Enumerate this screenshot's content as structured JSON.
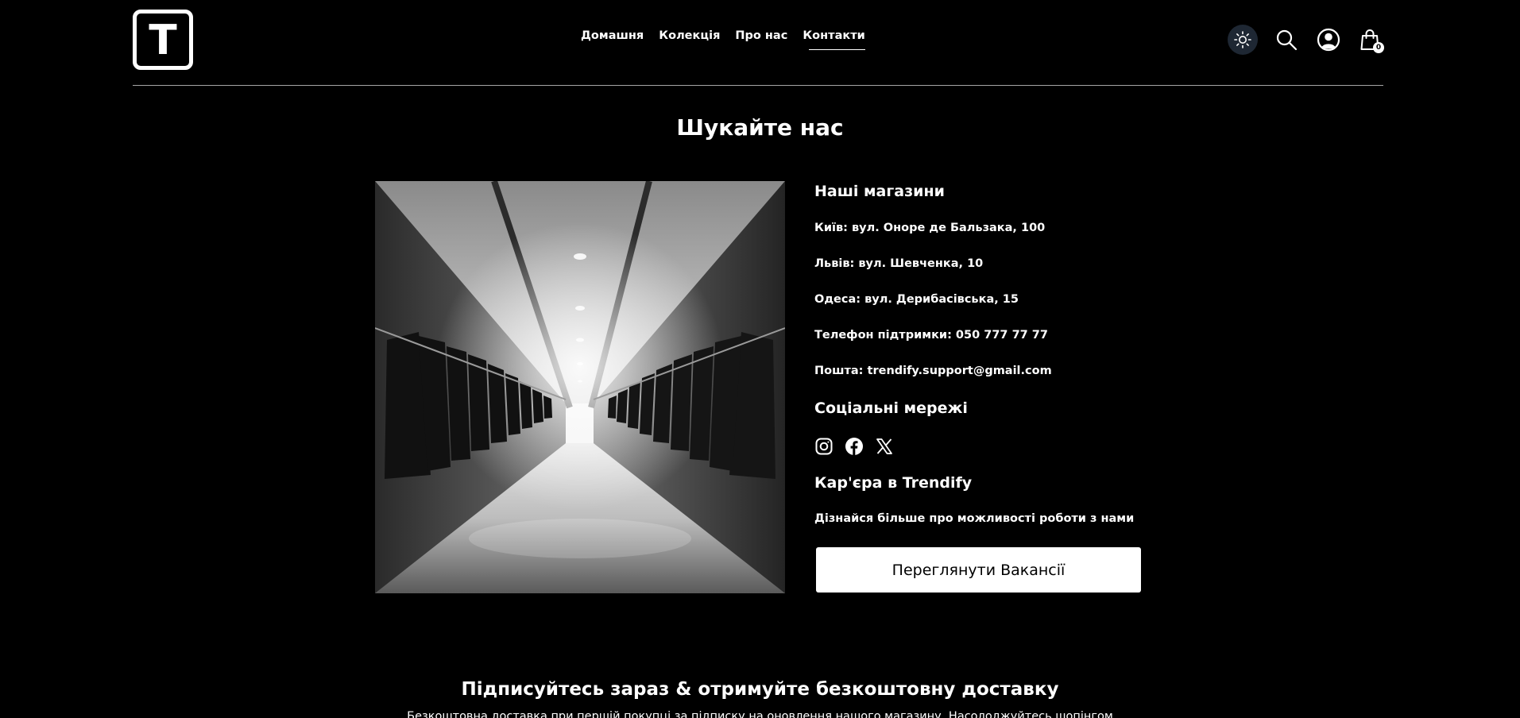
{
  "header": {
    "logo_letter": "T",
    "nav": [
      {
        "label": "Домашня"
      },
      {
        "label": "Колекція"
      },
      {
        "label": "Про нас"
      },
      {
        "label": "Контакти",
        "active": true
      }
    ],
    "icons": [
      "sun-icon",
      "search-icon",
      "user-icon",
      "cart-icon"
    ],
    "cart_count": "0"
  },
  "main": {
    "title": "Шукайте нас",
    "stores_title": "Наші магазини",
    "stores": [
      "Київ: вул. Оноре де Бальзака, 100",
      "Львів: вул. Шевченка, 10",
      "Одеса: вул. Дерибасівська, 15"
    ],
    "phone": "Телефон підтримки: 050 777 77 77",
    "email": "Пошта: trendify.support@gmail.com",
    "social_title": "Соціальні мережі",
    "social_icons": [
      "instagram-icon",
      "facebook-icon",
      "x-icon"
    ],
    "career_title": "Кар'єра в Trendify",
    "career_text": "Дізнайся більше про можливості роботи з нами",
    "vacancies_button": "Переглянути Вакансії"
  },
  "subscribe": {
    "title": "Підписуйтесь зараз & отримуйте безкоштовну доставку",
    "text": "Безкоштовна доставка при першій покупці за підписку на оновлення нашого магазину. Насолоджуйтесь шопінгом"
  },
  "colors": {
    "background": "#000000",
    "text": "#ffffff",
    "theme_button_bg": "#1e2733",
    "divider": "#a6a6a6"
  }
}
